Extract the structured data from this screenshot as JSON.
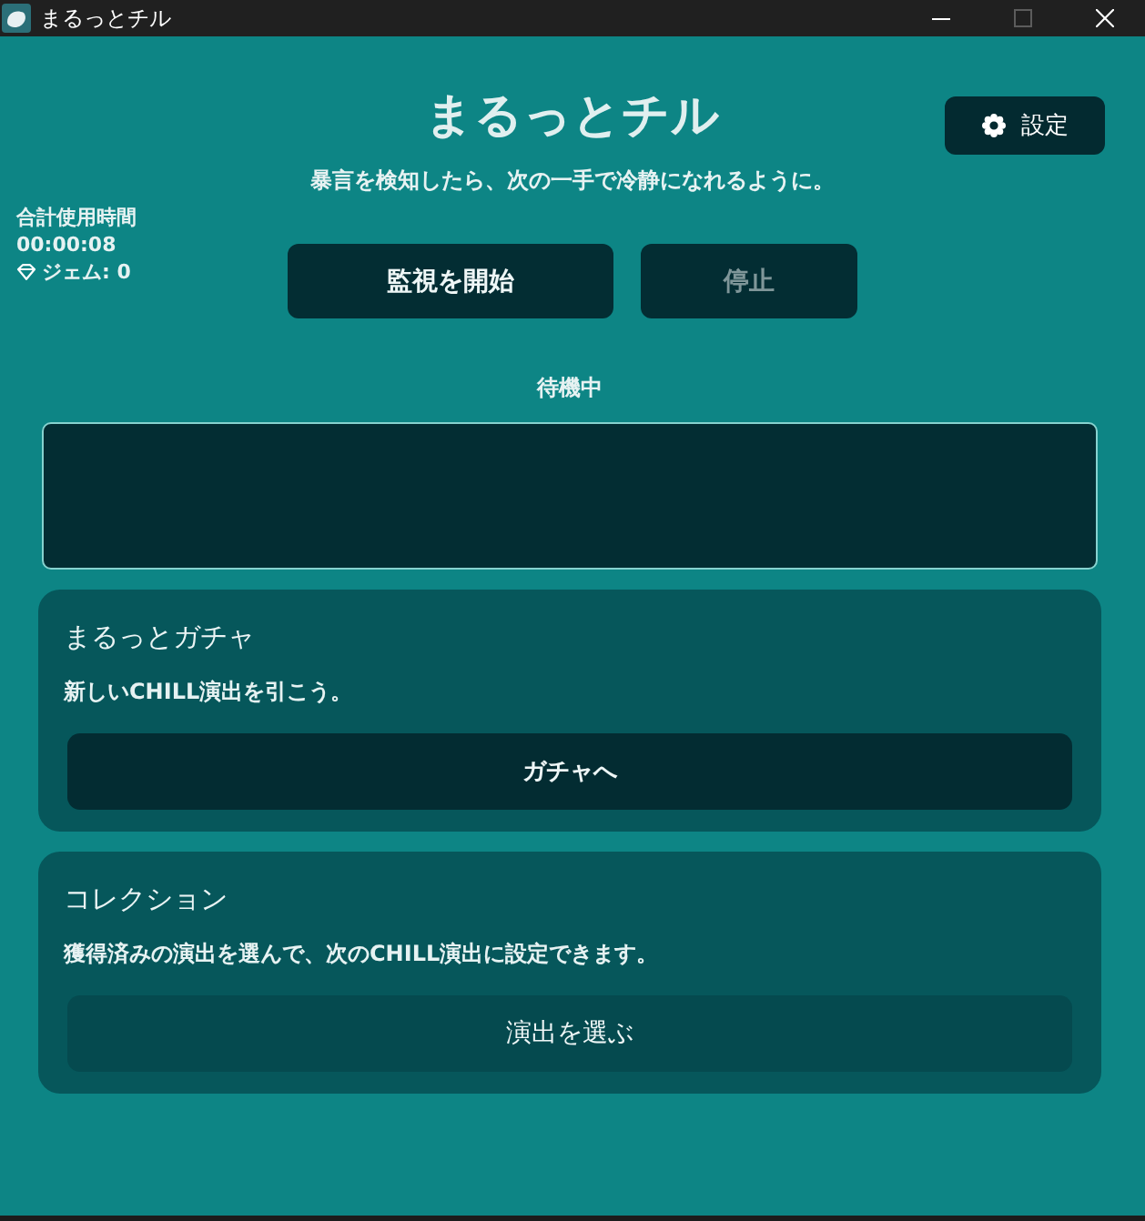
{
  "window": {
    "title": "まるっとチル",
    "maximize_disabled": true
  },
  "header": {
    "title": "まるっとチル",
    "settings_button": "設定",
    "subtitle": "暴言を検知したら、次の一手で冷静になれるように。"
  },
  "stats": {
    "usage_label": "合計使用時間",
    "usage_time": "00:00:08",
    "gems": "ジェム: 0"
  },
  "controls": [
    {
      "label": "監視を開始",
      "disabled": false
    },
    {
      "label": "停止",
      "disabled": true
    }
  ],
  "status": {
    "text": "待機中"
  },
  "cards": [
    {
      "title": "まるっとガチャ",
      "description": "新しいCHILL演出を引こう。",
      "button": {
        "label": "ガチャへ",
        "kind": "primary"
      }
    },
    {
      "title": "コレクション",
      "description": "獲得済みの演出を選んで、次のCHILL演出に設定できます。",
      "button": {
        "label": "演出を選ぶ",
        "kind": "secondary"
      }
    }
  ]
}
